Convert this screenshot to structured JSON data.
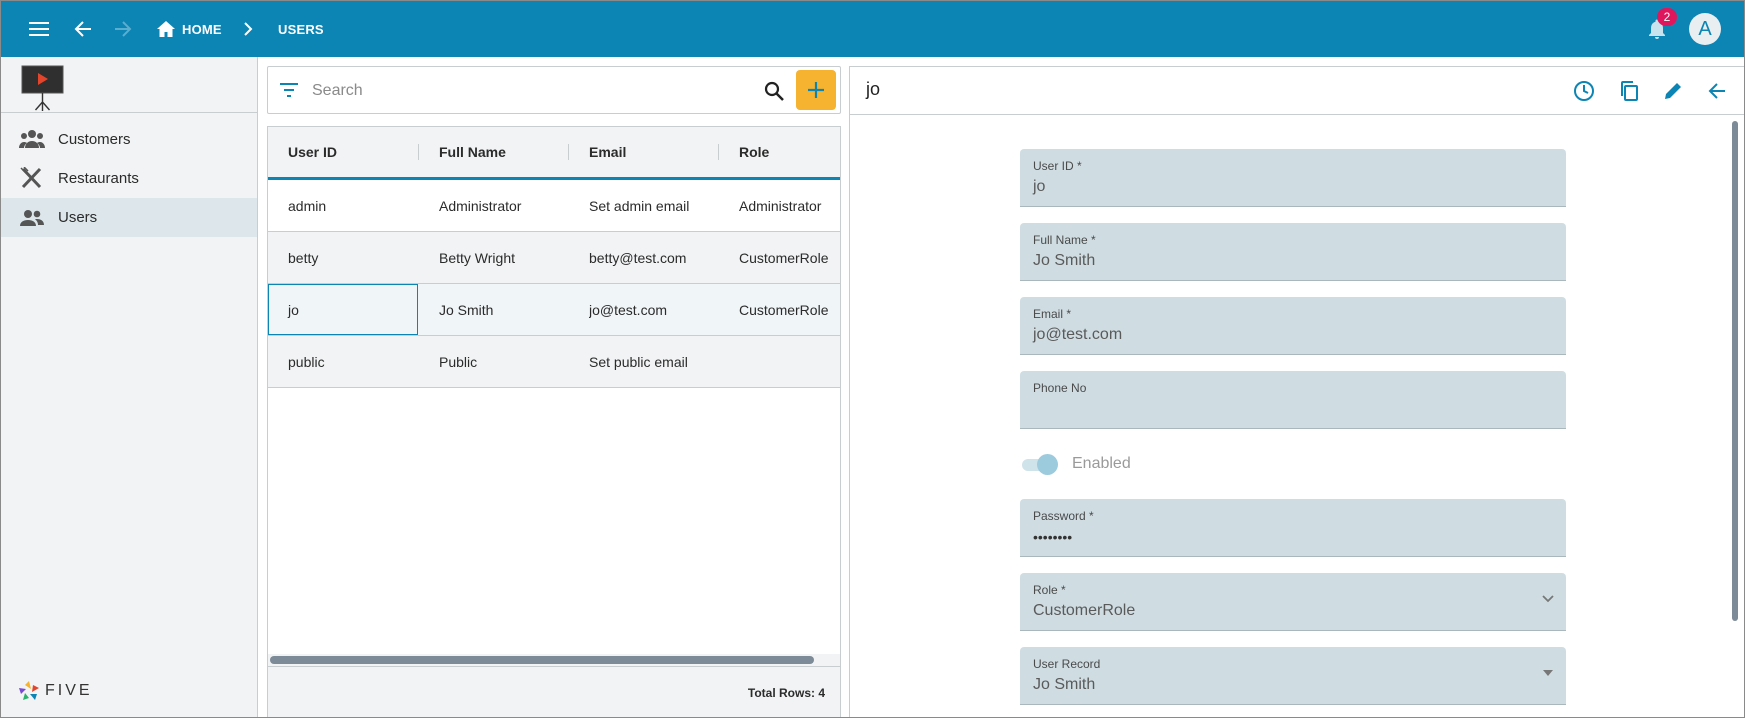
{
  "topbar": {
    "home_label": "HOME",
    "current_label": "USERS",
    "notification_count": "2",
    "avatar_letter": "A",
    "accent_color": "#0d85b4"
  },
  "sidebar": {
    "items": [
      {
        "label": "Customers",
        "icon": "customers-icon"
      },
      {
        "label": "Restaurants",
        "icon": "restaurants-icon"
      },
      {
        "label": "Users",
        "icon": "users-icon",
        "active": true
      }
    ],
    "brand": "FIVE"
  },
  "list": {
    "search_placeholder": "Search",
    "columns": [
      "User ID",
      "Full Name",
      "Email",
      "Role"
    ],
    "rows": [
      {
        "user_id": "admin",
        "full_name": "Administrator",
        "email": "Set admin email",
        "role": "Administrator"
      },
      {
        "user_id": "betty",
        "full_name": "Betty Wright",
        "email": "betty@test.com",
        "role": "CustomerRole"
      },
      {
        "user_id": "jo",
        "full_name": "Jo Smith",
        "email": "jo@test.com",
        "role": "CustomerRole"
      },
      {
        "user_id": "public",
        "full_name": "Public",
        "email": "Set public email",
        "role": ""
      }
    ],
    "total_rows": "Total Rows: 4",
    "add_color": "#f5b32f"
  },
  "detail": {
    "title": "jo",
    "fields": {
      "user_id": {
        "label": "User ID *",
        "value": "jo"
      },
      "full_name": {
        "label": "Full Name *",
        "value": "Jo Smith"
      },
      "email": {
        "label": "Email *",
        "value": "jo@test.com"
      },
      "phone": {
        "label": "Phone No",
        "value": ""
      },
      "enabled": {
        "label": "Enabled",
        "value": true
      },
      "password": {
        "label": "Password *",
        "value": "••••••••"
      },
      "role": {
        "label": "Role *",
        "value": "CustomerRole"
      },
      "user_record": {
        "label": "User Record",
        "value": "Jo Smith"
      }
    }
  }
}
